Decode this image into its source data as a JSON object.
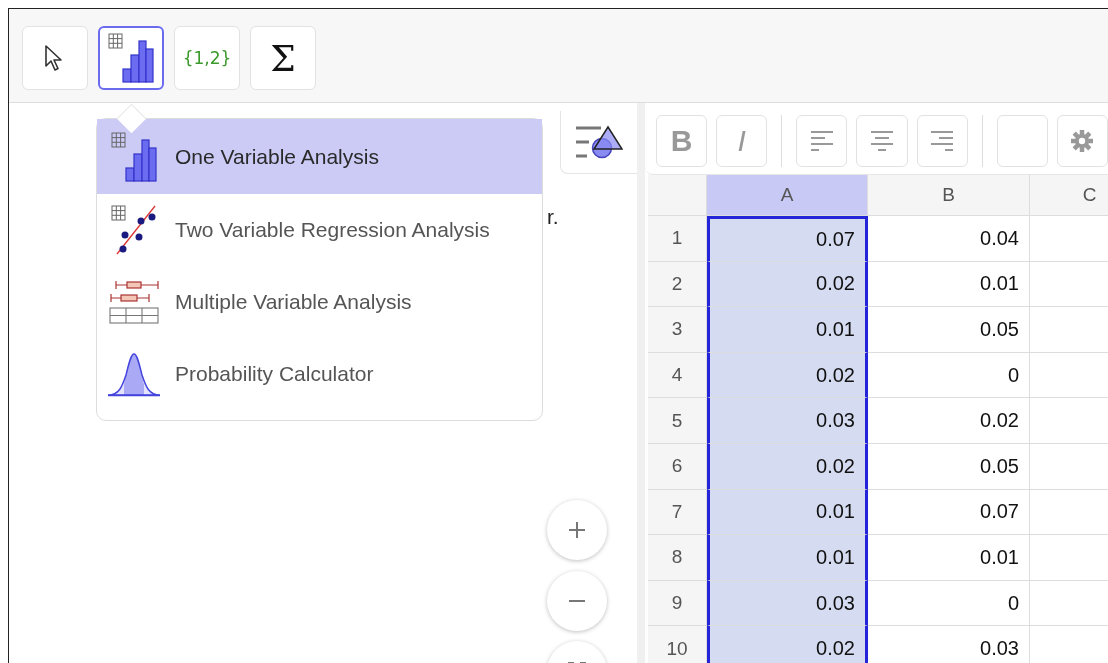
{
  "toolbar": {
    "tools": [
      {
        "kind": "move",
        "selected": false
      },
      {
        "kind": "one-variable",
        "selected": true
      },
      {
        "kind": "list",
        "label": "{1,2}",
        "selected": false
      },
      {
        "kind": "sum",
        "label": "Σ",
        "selected": false
      }
    ]
  },
  "tool_menu": {
    "items": [
      {
        "kind": "one-variable",
        "label": "One Variable Analysis",
        "selected": true
      },
      {
        "kind": "two-variable",
        "label": "Two Variable Regression Analysis",
        "selected": false
      },
      {
        "kind": "multiple-variable",
        "label": "Multiple Variable Analysis",
        "selected": false
      },
      {
        "kind": "probability",
        "label": "Probability Calculator",
        "selected": false
      }
    ]
  },
  "graphics": {
    "text": "r."
  },
  "spreadsheet": {
    "style_bar": [
      {
        "kind": "bold",
        "label": "B"
      },
      {
        "kind": "italic",
        "label": "I"
      },
      {
        "kind": "align-left"
      },
      {
        "kind": "align-center"
      },
      {
        "kind": "align-right"
      },
      {
        "kind": "color"
      },
      {
        "kind": "settings"
      }
    ],
    "columns": [
      {
        "label": "A",
        "selected": true
      },
      {
        "label": "B",
        "selected": false
      },
      {
        "label": "C",
        "selected": false
      }
    ],
    "rows": [
      {
        "number": "1",
        "cells": [
          "0.07",
          "0.04"
        ]
      },
      {
        "number": "2",
        "cells": [
          "0.02",
          "0.01"
        ]
      },
      {
        "number": "3",
        "cells": [
          "0.01",
          "0.05"
        ]
      },
      {
        "number": "4",
        "cells": [
          "0.02",
          "0"
        ]
      },
      {
        "number": "5",
        "cells": [
          "0.03",
          "0.02"
        ]
      },
      {
        "number": "6",
        "cells": [
          "0.02",
          "0.05"
        ]
      },
      {
        "number": "7",
        "cells": [
          "0.01",
          "0.07"
        ]
      },
      {
        "number": "8",
        "cells": [
          "0.01",
          "0.01"
        ]
      },
      {
        "number": "9",
        "cells": [
          "0.03",
          "0"
        ]
      },
      {
        "number": "10",
        "cells": [
          "0.02",
          "0.03"
        ]
      }
    ]
  }
}
